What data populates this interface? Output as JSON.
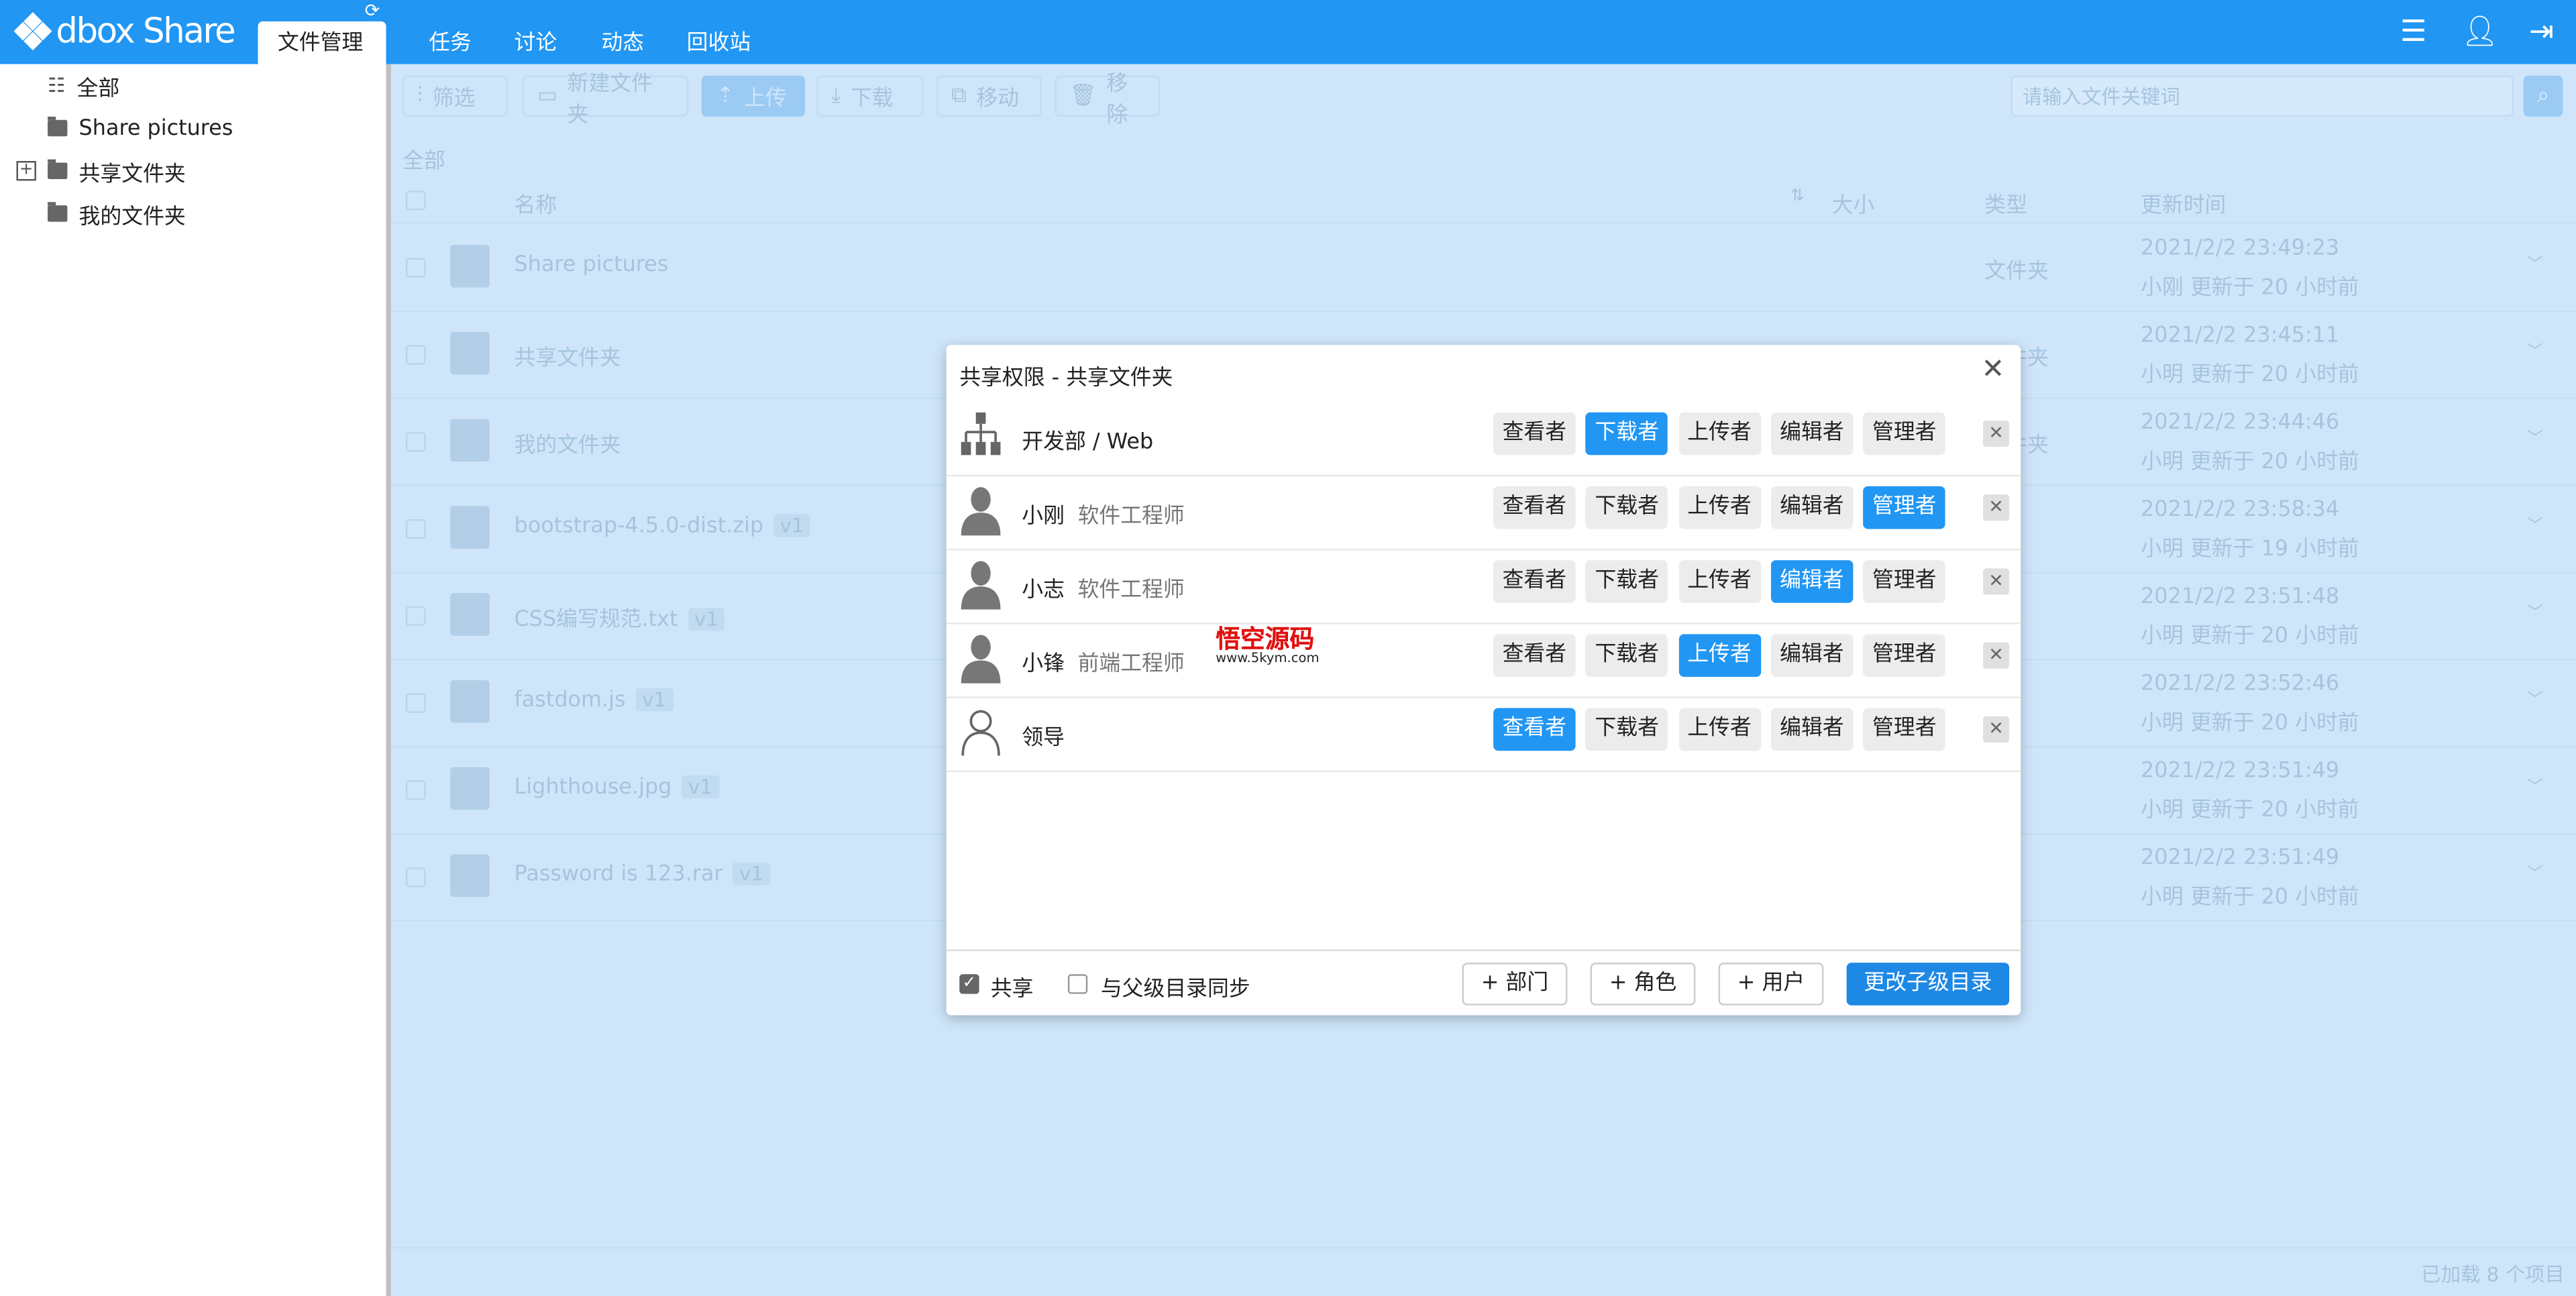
{
  "header": {
    "logo": "dbox Share",
    "tabs": [
      "文件管理",
      "任务",
      "讨论",
      "动态",
      "回收站"
    ],
    "active_tab": 0
  },
  "sidebar": {
    "items": [
      {
        "label": "全部",
        "icon": "list-icon"
      },
      {
        "label": "Share pictures",
        "icon": "folder-icon"
      },
      {
        "label": "共享文件夹",
        "icon": "folder-icon",
        "expandable": true
      },
      {
        "label": "我的文件夹",
        "icon": "folder-icon"
      }
    ]
  },
  "toolbar": {
    "filter": "筛选",
    "new_folder": "新建文件夹",
    "upload": "上传",
    "download": "下载",
    "move": "移动",
    "remove": "移除",
    "search_placeholder": "请输入文件关键词"
  },
  "breadcrumb": "全部",
  "table": {
    "headers": {
      "name": "名称",
      "size": "大小",
      "type": "类型",
      "updated": "更新时间"
    },
    "rows": [
      {
        "name": "Share pictures",
        "icon": "shared-folder-icon",
        "type": "文件夹",
        "date": "2021/2/2 23:49:23",
        "by": "小刚 更新于 20 小时前"
      },
      {
        "name": "共享文件夹",
        "icon": "shared-folder-icon",
        "type": "文件夹",
        "date": "2021/2/2 23:45:11",
        "by": "小明 更新于 20 小时前"
      },
      {
        "name": "我的文件夹",
        "icon": "folder-icon",
        "type": "文件夹",
        "date": "2021/2/2 23:44:46",
        "by": "小明 更新于 20 小时前"
      },
      {
        "name": "bootstrap-4.5.0-dist.zip",
        "version": "v1",
        "icon": "zip-icon",
        "date": "2021/2/2 23:58:34",
        "by": "小明 更新于 19 小时前"
      },
      {
        "name": "CSS编写规范.txt",
        "version": "v1",
        "icon": "text-file-icon",
        "date": "2021/2/2 23:51:48",
        "by": "小明 更新于 20 小时前"
      },
      {
        "name": "fastdom.js",
        "version": "v1",
        "icon": "code-file-icon",
        "date": "2021/2/2 23:52:46",
        "by": "小明 更新于 20 小时前"
      },
      {
        "name": "Lighthouse.jpg",
        "version": "v1",
        "icon": "image-file-icon",
        "date": "2021/2/2 23:51:49",
        "by": "小明 更新于 20 小时前"
      },
      {
        "name": "Password is 123.rar",
        "version": "v1",
        "icon": "zip-icon",
        "date": "2021/2/2 23:51:49",
        "by": "小明 更新于 20 小时前"
      }
    ]
  },
  "status": "已加载 8 个项目",
  "dialog": {
    "title": "共享权限 - 共享文件夹",
    "roles": [
      "查看者",
      "下载者",
      "上传者",
      "编辑者",
      "管理者"
    ],
    "entries": [
      {
        "name": "开发部 / Web",
        "role": "",
        "icon": "org-chart-icon",
        "selected": 1
      },
      {
        "name": "小刚",
        "role": "软件工程师",
        "icon": "user-icon",
        "selected": 4
      },
      {
        "name": "小志",
        "role": "软件工程师",
        "icon": "user-icon",
        "selected": 3
      },
      {
        "name": "小锋",
        "role": "前端工程师",
        "icon": "user-icon",
        "selected": 2
      },
      {
        "name": "领导",
        "role": "",
        "icon": "user-outline-icon",
        "selected": 0
      }
    ],
    "share_label": "共享",
    "share_checked": true,
    "sync_label": "与父级目录同步",
    "sync_checked": false,
    "add_dept": "+ 部门",
    "add_role": "+ 角色",
    "add_user": "+ 用户",
    "apply_children": "更改子级目录"
  },
  "watermark": {
    "text": "悟空源码",
    "url": "www.5kym.com"
  },
  "colors": {
    "primary": "#2196f3",
    "overlay": "#cfe6fa"
  }
}
